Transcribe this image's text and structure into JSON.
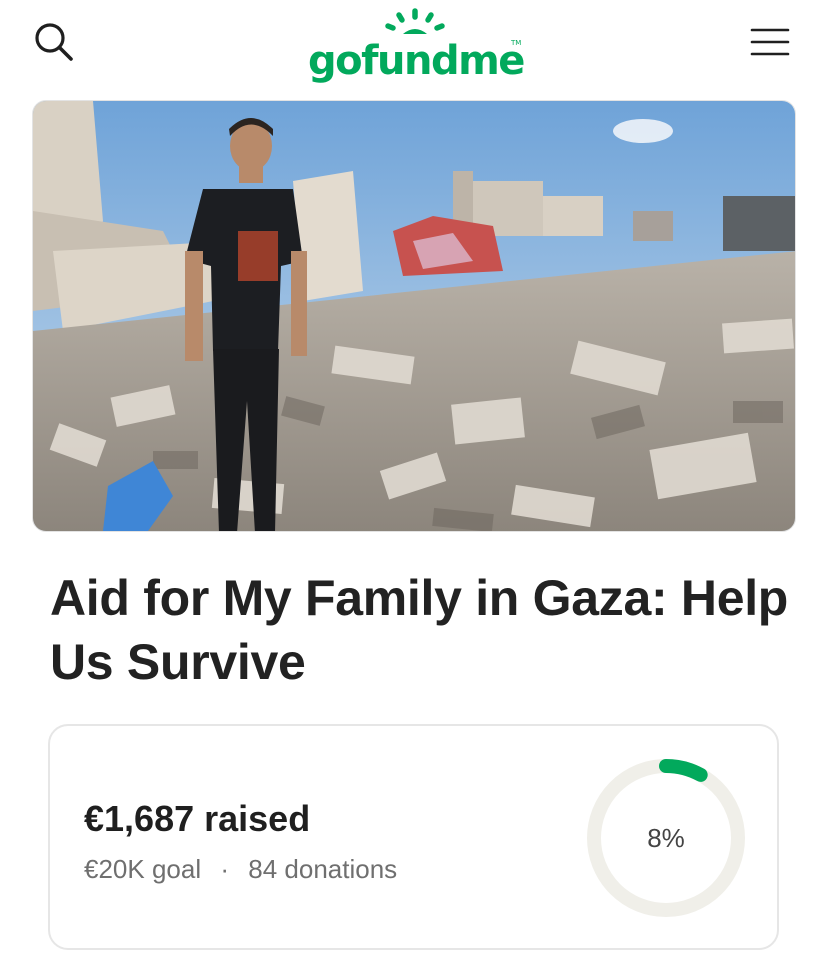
{
  "header": {
    "logo_text": "gofundme",
    "logo_tm": "TM",
    "brand_color": "#02a95c",
    "search_icon": "search-icon",
    "menu_icon": "hamburger-menu-icon"
  },
  "hero": {
    "image_subject": "man standing in rubble of destroyed buildings"
  },
  "campaign": {
    "title": "Aid for My Family in Gaza: Help Us Survive"
  },
  "progress": {
    "raised_text": "€1,687 raised",
    "goal_text": "€20K goal",
    "separator": "·",
    "donations_text": "84 donations",
    "percent_label": "8%",
    "percent_value": 8,
    "ring_color": "#02a95c",
    "track_color": "#f0efe9"
  }
}
